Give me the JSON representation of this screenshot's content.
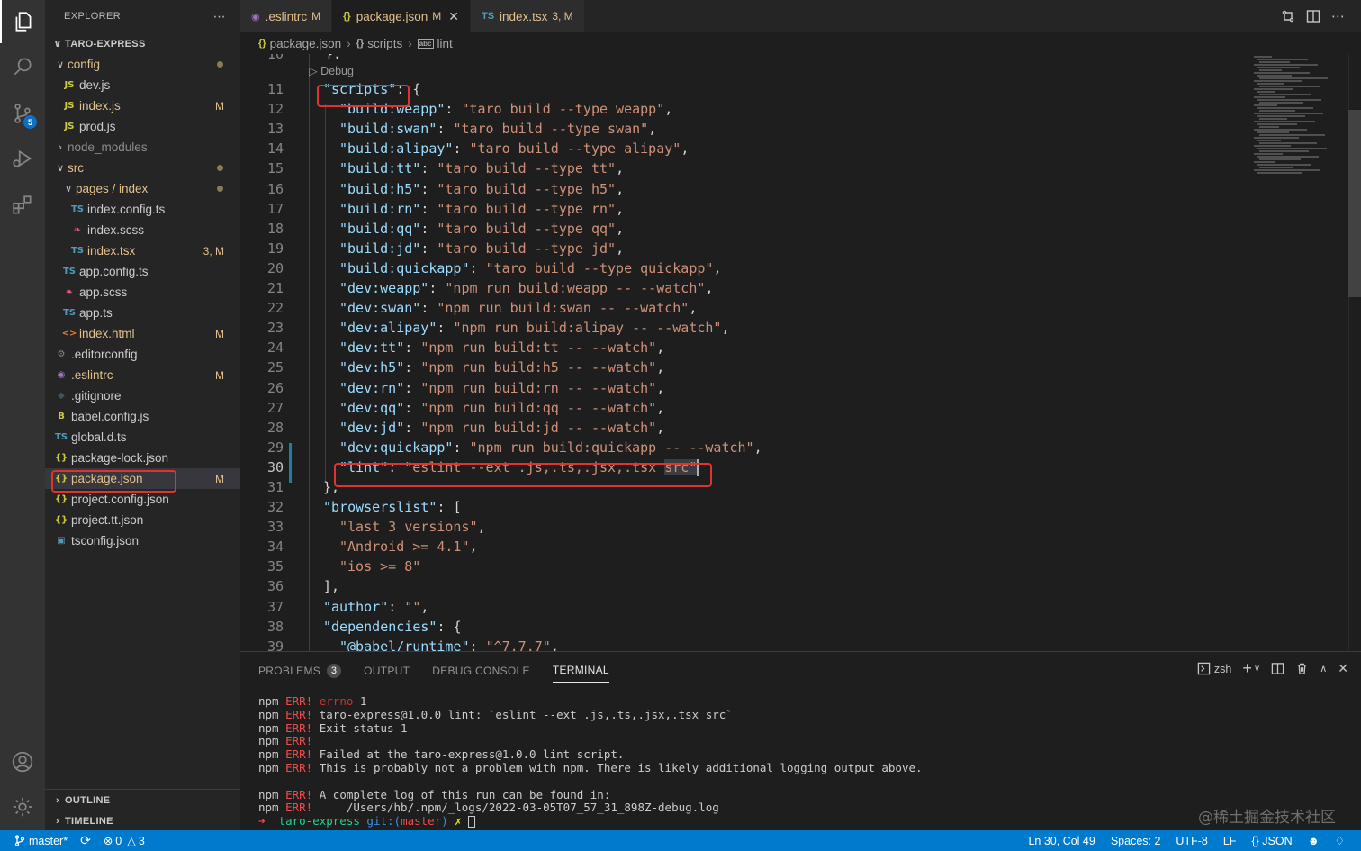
{
  "explorer": {
    "title": "EXPLORER",
    "more": "⋯",
    "root": "TARO-EXPRESS",
    "items": [
      {
        "label": "config",
        "icon": "folder-open",
        "depth": 1,
        "chev": "∨",
        "status": "dot",
        "cls": "mod"
      },
      {
        "label": "dev.js",
        "icon": "JS",
        "depth": 2,
        "status": "",
        "cls": ""
      },
      {
        "label": "index.js",
        "icon": "JS",
        "depth": 2,
        "status": "M",
        "cls": "mod"
      },
      {
        "label": "prod.js",
        "icon": "JS",
        "depth": 2,
        "status": "",
        "cls": ""
      },
      {
        "label": "node_modules",
        "icon": "folder",
        "depth": 1,
        "chev": "›",
        "status": "",
        "cls": "dim"
      },
      {
        "label": "src",
        "icon": "folder-open",
        "depth": 1,
        "chev": "∨",
        "status": "dot",
        "cls": "mod"
      },
      {
        "label": "pages / index",
        "icon": "folder-open",
        "depth": 2,
        "chev": "∨",
        "status": "dot",
        "cls": "mod"
      },
      {
        "label": "index.config.ts",
        "icon": "TS",
        "depth": 3,
        "status": "",
        "cls": ""
      },
      {
        "label": "index.scss",
        "icon": "scss",
        "depth": 3,
        "status": "",
        "cls": ""
      },
      {
        "label": "index.tsx",
        "icon": "TS",
        "depth": 3,
        "status": "3, M",
        "cls": "err"
      },
      {
        "label": "app.config.ts",
        "icon": "TS",
        "depth": 2,
        "status": "",
        "cls": ""
      },
      {
        "label": "app.scss",
        "icon": "scss",
        "depth": 2,
        "status": "",
        "cls": ""
      },
      {
        "label": "app.ts",
        "icon": "TS",
        "depth": 2,
        "status": "",
        "cls": ""
      },
      {
        "label": "index.html",
        "icon": "html",
        "depth": 2,
        "status": "M",
        "cls": "mod"
      },
      {
        "label": ".editorconfig",
        "icon": "gear",
        "depth": 1,
        "status": "",
        "cls": ""
      },
      {
        "label": ".eslintrc",
        "icon": "eslint",
        "depth": 1,
        "status": "M",
        "cls": "mod"
      },
      {
        "label": ".gitignore",
        "icon": "git",
        "depth": 1,
        "status": "",
        "cls": ""
      },
      {
        "label": "babel.config.js",
        "icon": "babel",
        "depth": 1,
        "status": "",
        "cls": ""
      },
      {
        "label": "global.d.ts",
        "icon": "TS",
        "depth": 1,
        "status": "",
        "cls": ""
      },
      {
        "label": "package-lock.json",
        "icon": "json",
        "depth": 1,
        "status": "",
        "cls": ""
      },
      {
        "label": "package.json",
        "icon": "json",
        "depth": 1,
        "status": "M",
        "cls": "mod",
        "selected": true
      },
      {
        "label": "project.config.json",
        "icon": "json",
        "depth": 1,
        "status": "",
        "cls": ""
      },
      {
        "label": "project.tt.json",
        "icon": "json",
        "depth": 1,
        "status": "",
        "cls": ""
      },
      {
        "label": "tsconfig.json",
        "icon": "tsconfig",
        "depth": 1,
        "status": "",
        "cls": ""
      }
    ],
    "outline": "OUTLINE",
    "timeline": "TIMELINE"
  },
  "activity_badge": "5",
  "tabs": [
    {
      "label": ".eslintrc",
      "mod": "M",
      "icon": "◉",
      "icon_color": "#a074c4",
      "active": false
    },
    {
      "label": "package.json",
      "mod": "M",
      "icon": "{}",
      "icon_color": "#cbcb41",
      "active": true,
      "close": "✕"
    },
    {
      "label": "index.tsx",
      "mod": "3, M",
      "icon": "TS",
      "icon_color": "#519aba",
      "active": false
    }
  ],
  "breadcrumb": {
    "file": "package.json",
    "node1": "scripts",
    "node2": "lint",
    "file_icon": "{}",
    "node1_icon": "{}",
    "node2_icon": "abc"
  },
  "editor": {
    "codelens": "▷ Debug",
    "first_partial_line": "10",
    "first_partial_code": "},",
    "lines": [
      {
        "n": "11",
        "code": [
          [
            "k",
            "\"scripts\""
          ],
          [
            "p",
            ": {"
          ]
        ],
        "indent": 0
      },
      {
        "n": "12",
        "code": [
          [
            "k",
            "\"build:weapp\""
          ],
          [
            "p",
            ": "
          ],
          [
            "s",
            "\"taro build --type weapp\""
          ],
          [
            "p",
            ","
          ]
        ],
        "indent": 1
      },
      {
        "n": "13",
        "code": [
          [
            "k",
            "\"build:swan\""
          ],
          [
            "p",
            ": "
          ],
          [
            "s",
            "\"taro build --type swan\""
          ],
          [
            "p",
            ","
          ]
        ],
        "indent": 1
      },
      {
        "n": "14",
        "code": [
          [
            "k",
            "\"build:alipay\""
          ],
          [
            "p",
            ": "
          ],
          [
            "s",
            "\"taro build --type alipay\""
          ],
          [
            "p",
            ","
          ]
        ],
        "indent": 1
      },
      {
        "n": "15",
        "code": [
          [
            "k",
            "\"build:tt\""
          ],
          [
            "p",
            ": "
          ],
          [
            "s",
            "\"taro build --type tt\""
          ],
          [
            "p",
            ","
          ]
        ],
        "indent": 1
      },
      {
        "n": "16",
        "code": [
          [
            "k",
            "\"build:h5\""
          ],
          [
            "p",
            ": "
          ],
          [
            "s",
            "\"taro build --type h5\""
          ],
          [
            "p",
            ","
          ]
        ],
        "indent": 1
      },
      {
        "n": "17",
        "code": [
          [
            "k",
            "\"build:rn\""
          ],
          [
            "p",
            ": "
          ],
          [
            "s",
            "\"taro build --type rn\""
          ],
          [
            "p",
            ","
          ]
        ],
        "indent": 1
      },
      {
        "n": "18",
        "code": [
          [
            "k",
            "\"build:qq\""
          ],
          [
            "p",
            ": "
          ],
          [
            "s",
            "\"taro build --type qq\""
          ],
          [
            "p",
            ","
          ]
        ],
        "indent": 1
      },
      {
        "n": "19",
        "code": [
          [
            "k",
            "\"build:jd\""
          ],
          [
            "p",
            ": "
          ],
          [
            "s",
            "\"taro build --type jd\""
          ],
          [
            "p",
            ","
          ]
        ],
        "indent": 1
      },
      {
        "n": "20",
        "code": [
          [
            "k",
            "\"build:quickapp\""
          ],
          [
            "p",
            ": "
          ],
          [
            "s",
            "\"taro build --type quickapp\""
          ],
          [
            "p",
            ","
          ]
        ],
        "indent": 1
      },
      {
        "n": "21",
        "code": [
          [
            "k",
            "\"dev:weapp\""
          ],
          [
            "p",
            ": "
          ],
          [
            "s",
            "\"npm run build:weapp -- --watch\""
          ],
          [
            "p",
            ","
          ]
        ],
        "indent": 1
      },
      {
        "n": "22",
        "code": [
          [
            "k",
            "\"dev:swan\""
          ],
          [
            "p",
            ": "
          ],
          [
            "s",
            "\"npm run build:swan -- --watch\""
          ],
          [
            "p",
            ","
          ]
        ],
        "indent": 1
      },
      {
        "n": "23",
        "code": [
          [
            "k",
            "\"dev:alipay\""
          ],
          [
            "p",
            ": "
          ],
          [
            "s",
            "\"npm run build:alipay -- --watch\""
          ],
          [
            "p",
            ","
          ]
        ],
        "indent": 1
      },
      {
        "n": "24",
        "code": [
          [
            "k",
            "\"dev:tt\""
          ],
          [
            "p",
            ": "
          ],
          [
            "s",
            "\"npm run build:tt -- --watch\""
          ],
          [
            "p",
            ","
          ]
        ],
        "indent": 1
      },
      {
        "n": "25",
        "code": [
          [
            "k",
            "\"dev:h5\""
          ],
          [
            "p",
            ": "
          ],
          [
            "s",
            "\"npm run build:h5 -- --watch\""
          ],
          [
            "p",
            ","
          ]
        ],
        "indent": 1
      },
      {
        "n": "26",
        "code": [
          [
            "k",
            "\"dev:rn\""
          ],
          [
            "p",
            ": "
          ],
          [
            "s",
            "\"npm run build:rn -- --watch\""
          ],
          [
            "p",
            ","
          ]
        ],
        "indent": 1
      },
      {
        "n": "27",
        "code": [
          [
            "k",
            "\"dev:qq\""
          ],
          [
            "p",
            ": "
          ],
          [
            "s",
            "\"npm run build:qq -- --watch\""
          ],
          [
            "p",
            ","
          ]
        ],
        "indent": 1
      },
      {
        "n": "28",
        "code": [
          [
            "k",
            "\"dev:jd\""
          ],
          [
            "p",
            ": "
          ],
          [
            "s",
            "\"npm run build:jd -- --watch\""
          ],
          [
            "p",
            ","
          ]
        ],
        "indent": 1
      },
      {
        "n": "29",
        "code": [
          [
            "k",
            "\"dev:quickapp\""
          ],
          [
            "p",
            ": "
          ],
          [
            "s",
            "\"npm run build:quickapp -- --watch\""
          ],
          [
            "p",
            ","
          ]
        ],
        "indent": 1
      },
      {
        "n": "30",
        "code": [
          [
            "k",
            "\"lint\""
          ],
          [
            "p",
            ": "
          ],
          [
            "s",
            "\"eslint --ext .js,.ts,.jsx,.tsx "
          ],
          [
            "sel",
            "src\""
          ]
        ],
        "indent": 1,
        "active": true
      },
      {
        "n": "31",
        "code": [
          [
            "p",
            "},"
          ]
        ],
        "indent": 0
      },
      {
        "n": "32",
        "code": [
          [
            "k",
            "\"browserslist\""
          ],
          [
            "p",
            ": ["
          ]
        ],
        "indent": 0
      },
      {
        "n": "33",
        "code": [
          [
            "s",
            "\"last 3 versions\""
          ],
          [
            "p",
            ","
          ]
        ],
        "indent": 1
      },
      {
        "n": "34",
        "code": [
          [
            "s",
            "\"Android >= 4.1\""
          ],
          [
            "p",
            ","
          ]
        ],
        "indent": 1
      },
      {
        "n": "35",
        "code": [
          [
            "s",
            "\"ios >= 8\""
          ]
        ],
        "indent": 1
      },
      {
        "n": "36",
        "code": [
          [
            "p",
            "],"
          ]
        ],
        "indent": 0
      },
      {
        "n": "37",
        "code": [
          [
            "k",
            "\"author\""
          ],
          [
            "p",
            ": "
          ],
          [
            "s",
            "\"\""
          ],
          [
            "p",
            ","
          ]
        ],
        "indent": 0
      },
      {
        "n": "38",
        "code": [
          [
            "k",
            "\"dependencies\""
          ],
          [
            "p",
            ": {"
          ]
        ],
        "indent": 0
      },
      {
        "n": "39",
        "code": [
          [
            "k",
            "\"@babel/runtime\""
          ],
          [
            "p",
            ": "
          ],
          [
            "s",
            "\"^7.7.7\""
          ],
          [
            "p",
            ","
          ]
        ],
        "indent": 1
      }
    ]
  },
  "panel": {
    "tabs": [
      {
        "label": "PROBLEMS",
        "count": "3",
        "active": false
      },
      {
        "label": "OUTPUT",
        "active": false
      },
      {
        "label": "DEBUG CONSOLE",
        "active": false
      },
      {
        "label": "TERMINAL",
        "active": true
      }
    ],
    "shell": "zsh",
    "terminal": [
      {
        "pre": "npm",
        "err": "ERR!",
        "rest_errno": "errno",
        "rest": " 1"
      },
      {
        "pre": "npm",
        "err": "ERR!",
        "rest": "taro-express@1.0.0 lint: `eslint --ext .js,.ts,.jsx,.tsx src`"
      },
      {
        "pre": "npm",
        "err": "ERR!",
        "rest": "Exit status 1"
      },
      {
        "pre": "npm",
        "err": "ERR!",
        "rest": ""
      },
      {
        "pre": "npm",
        "err": "ERR!",
        "rest": "Failed at the taro-express@1.0.0 lint script."
      },
      {
        "pre": "npm",
        "err": "ERR!",
        "rest": "This is probably not a problem with npm. There is likely additional logging output above."
      },
      {
        "pre": "",
        "err": "",
        "rest": ""
      },
      {
        "pre": "npm",
        "err": "ERR!",
        "rest": "A complete log of this run can be found in:"
      },
      {
        "pre": "npm",
        "err": "ERR!",
        "rest": "    /Users/hb/.npm/_logs/2022-03-05T07_57_31_898Z-debug.log"
      }
    ],
    "prompt": {
      "arrow": "➜",
      "repo": "taro-express",
      "git": "git:(",
      "branch": "master",
      "close": ")",
      "x": "✗"
    }
  },
  "watermark": "@稀土掘金技术社区",
  "status": {
    "branch": "master*",
    "errors": "0",
    "warnings": "3",
    "position": "Ln 30, Col 49",
    "spaces": "Spaces: 2",
    "encoding": "UTF-8",
    "eol": "LF",
    "language": "JSON",
    "language_icon": "{}"
  }
}
